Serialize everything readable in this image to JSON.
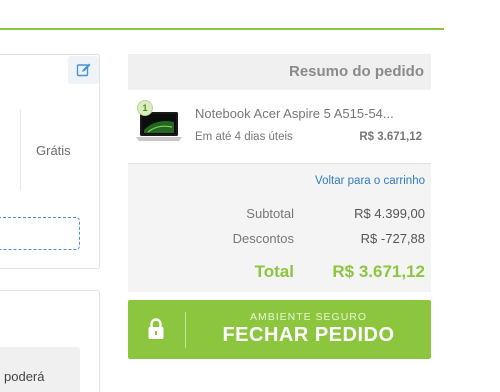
{
  "colors": {
    "accent": "#8cc63f",
    "link": "#2f7cc1",
    "panel": "#f4f4f4"
  },
  "left": {
    "edit_icon": "pencil-square-icon",
    "shipping_price": "Grátis",
    "notice_text": "poderá"
  },
  "summary": {
    "title": "Resumo do pedido",
    "item": {
      "quantity": "1",
      "name": "Notebook Acer Aspire 5 A515-54...",
      "delivery": "Em até 4 dias úteis",
      "price": "R$ 3.671,12"
    },
    "back_link": "Voltar para o carrinho",
    "subtotal_label": "Subtotal",
    "subtotal_value": "R$ 4.399,00",
    "discount_label": "Descontos",
    "discount_value": "R$ -727,88",
    "total_label": "Total",
    "total_value": "R$ 3.671,12"
  },
  "checkout": {
    "small_label": "AMBIENTE SEGURO",
    "big_label": "FECHAR PEDIDO",
    "icon": "lock-icon"
  }
}
